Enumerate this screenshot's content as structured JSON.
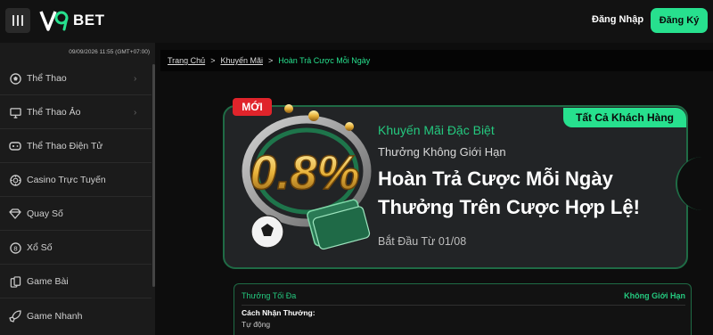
{
  "header": {
    "logo_text": "BET",
    "logo_mark": "V9",
    "login_label": "Đăng Nhập",
    "register_label": "Đăng Ký"
  },
  "sidebar": {
    "clock": "09/09/2026 11:55 (GMT+07:00)",
    "items": [
      {
        "label": "Thể Thao",
        "icon": "soccer-ball-icon",
        "has_chevron": true
      },
      {
        "label": "Thể Thao Ảo",
        "icon": "monitor-icon",
        "has_chevron": true
      },
      {
        "label": "Thể Thao Điện Tử",
        "icon": "gamepad-icon",
        "has_chevron": false
      },
      {
        "label": "Casino Trực Tuyến",
        "icon": "casino-chip-icon",
        "has_chevron": false
      },
      {
        "label": "Quay Số",
        "icon": "diamond-icon",
        "has_chevron": false
      },
      {
        "label": "Xổ Số",
        "icon": "lottery-ball-icon",
        "has_chevron": false
      },
      {
        "label": "Game Bài",
        "icon": "cards-icon",
        "has_chevron": false
      },
      {
        "label": "Game Nhanh",
        "icon": "rocket-icon",
        "has_chevron": false
      }
    ]
  },
  "breadcrumb": {
    "home": "Trang Chủ",
    "promos": "Khuyến Mãi",
    "current": "Hoàn Trả Cược Mỗi Ngày",
    "sep": ">"
  },
  "promo": {
    "new_badge": "MỚI",
    "audience_badge": "Tất Cả Khách Hàng",
    "subtitle1": "Khuyến Mãi Đặc Biệt",
    "subtitle2": "Thưởng Không Giới Hạn",
    "title_line1": "Hoàn Trả Cược Mỗi Ngày",
    "title_line2": "Thưởng Trên Cược Hợp Lệ!",
    "start_date": "Bắt Đầu Từ 01/08",
    "art_text": "0.8%"
  },
  "info": {
    "max_reward_label": "Thưởng Tối Đa",
    "max_reward_value": "Không Giới Hạn",
    "how_to_label": "Cách Nhận Thưởng:",
    "how_to_value": "Tự động"
  },
  "colors": {
    "accent": "#27e08e",
    "danger": "#e0242b",
    "bg": "#0d0d0d"
  }
}
